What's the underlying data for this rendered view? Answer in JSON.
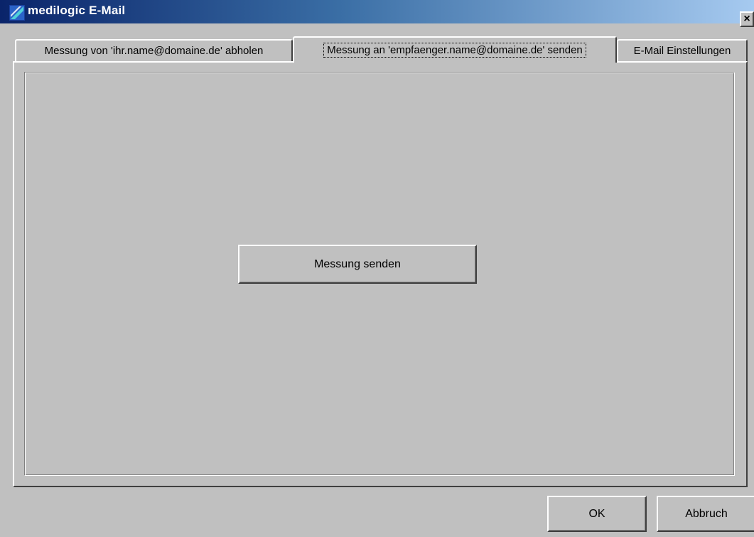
{
  "window": {
    "title": "medilogic E-Mail",
    "close_label": "×"
  },
  "tabs": [
    {
      "label": "Messung von 'ihr.name@domaine.de' abholen",
      "selected": false
    },
    {
      "label": "Messung an 'empfaenger.name@domaine.de' senden",
      "selected": true
    },
    {
      "label": "E-Mail Einstellungen",
      "selected": false
    }
  ],
  "panel": {
    "send_button_label": "Messung senden"
  },
  "footer": {
    "ok_label": "OK",
    "cancel_label": "Abbruch"
  },
  "colors": {
    "face": "#c0c0c0",
    "title_start": "#0a246a",
    "title_end": "#a6caf0"
  },
  "icons": {
    "app": "medilogic-app-icon",
    "close": "close-icon"
  }
}
